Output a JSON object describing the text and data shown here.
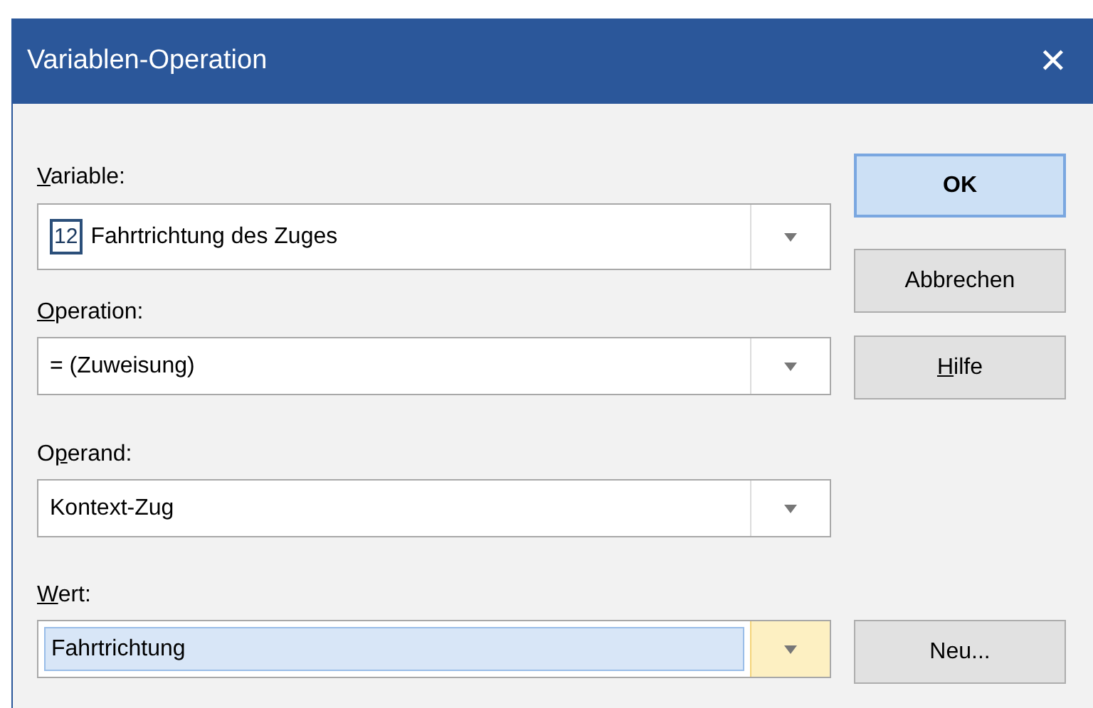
{
  "window": {
    "title": "Variablen-Operation",
    "close": "✕"
  },
  "fields": [
    {
      "label": {
        "key": "V",
        "post": "ariable:"
      },
      "value": "Fahrtrichtung des Zuges",
      "type_badge": "12",
      "focused": false
    },
    {
      "label": {
        "key": "O",
        "post": "peration:"
      },
      "value": "= (Zuweisung)",
      "focused": false
    },
    {
      "label": {
        "pre": "O",
        "key": "p",
        "post": "erand:"
      },
      "value": "Kontext-Zug",
      "focused": false
    },
    {
      "label": {
        "key": "W",
        "post": "ert:"
      },
      "value": "Fahrtrichtung",
      "focused": true
    }
  ],
  "buttons": [
    {
      "label": {
        "post": "OK"
      },
      "default": true
    },
    {
      "label": {
        "post": "Abbrechen"
      },
      "default": false
    },
    {
      "label": {
        "key": "H",
        "post": "ilfe"
      },
      "default": false
    },
    {
      "label": {
        "post": "Neu..."
      },
      "default": false
    }
  ]
}
